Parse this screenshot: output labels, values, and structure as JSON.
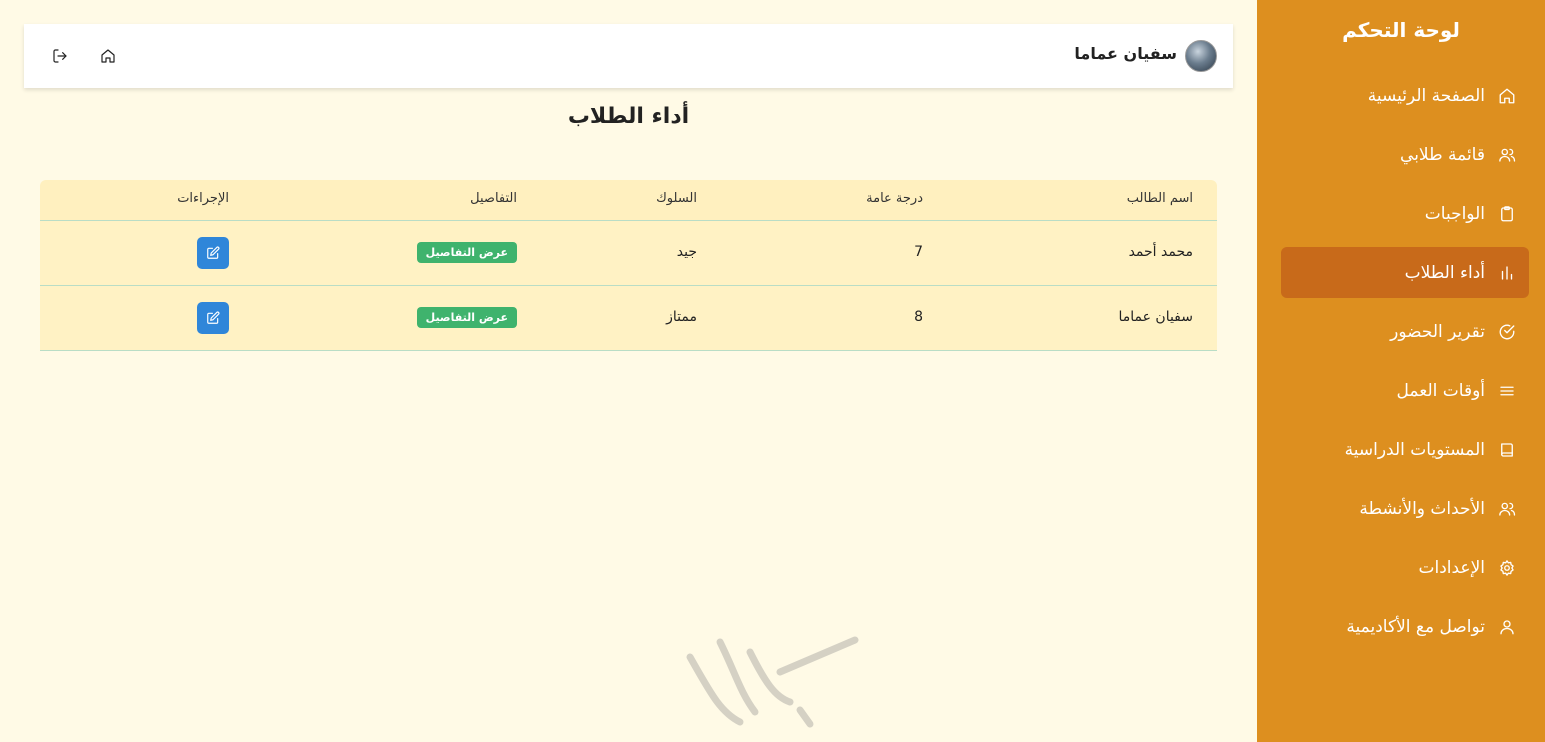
{
  "sidebar": {
    "title": "لوحة التحكم",
    "items": [
      {
        "label": "الصفحة الرئيسية",
        "icon": "home-icon",
        "active": false
      },
      {
        "label": "قائمة طلابي",
        "icon": "users-icon",
        "active": false
      },
      {
        "label": "الواجبات",
        "icon": "clipboard-icon",
        "active": false
      },
      {
        "label": "أداء الطلاب",
        "icon": "bar-chart-icon",
        "active": true
      },
      {
        "label": "تقرير الحضور",
        "icon": "check-circle-icon",
        "active": false
      },
      {
        "label": "أوقات العمل",
        "icon": "menu-lines-icon",
        "active": false
      },
      {
        "label": "المستويات الدراسية",
        "icon": "book-icon",
        "active": false
      },
      {
        "label": "الأحداث والأنشطة",
        "icon": "users-icon",
        "active": false
      },
      {
        "label": "الإعدادات",
        "icon": "gear-icon",
        "active": false
      },
      {
        "label": "تواصل مع الأكاديمية",
        "icon": "user-icon",
        "active": false
      }
    ]
  },
  "header": {
    "user_name": "سفيان عماما",
    "home_icon": "home-icon",
    "logout_icon": "logout-icon"
  },
  "page": {
    "title": "أداء الطلاب"
  },
  "table": {
    "headers": {
      "name": "اسم الطالب",
      "grade": "درجة عامة",
      "behavior": "السلوك",
      "details": "التفاصيل",
      "actions": "الإجراءات"
    },
    "rows": [
      {
        "name": "محمد أحمد",
        "grade": "7",
        "behavior": "جيد",
        "details_label": "عرض التفاصيل"
      },
      {
        "name": "سفيان عماما",
        "grade": "8",
        "behavior": "ممتاز",
        "details_label": "عرض التفاصيل"
      }
    ]
  },
  "colors": {
    "sidebar_bg": "#dd8f1f",
    "sidebar_active": "#c86a1a",
    "page_bg": "#fffae6",
    "details_button": "#3fb36d",
    "edit_button": "#2f86d9"
  }
}
